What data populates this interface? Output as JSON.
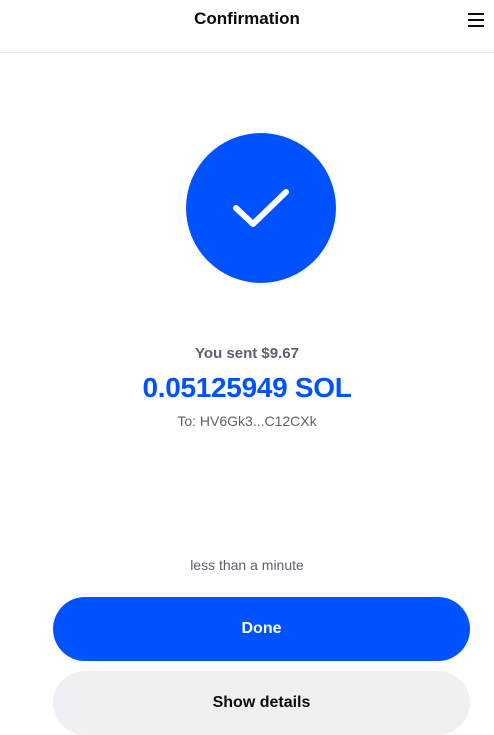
{
  "header": {
    "title": "Confirmation",
    "menu_icon": "hamburger-menu-icon"
  },
  "status": {
    "icon": "checkmark-icon",
    "accent_color": "#0052ff"
  },
  "transaction": {
    "sent_label": "You sent $9.67",
    "amount": "0.05125949 SOL",
    "recipient": "To: HV6Gk3...C12CXk",
    "eta": "less than a minute"
  },
  "actions": {
    "done_label": "Done",
    "details_label": "Show details"
  }
}
